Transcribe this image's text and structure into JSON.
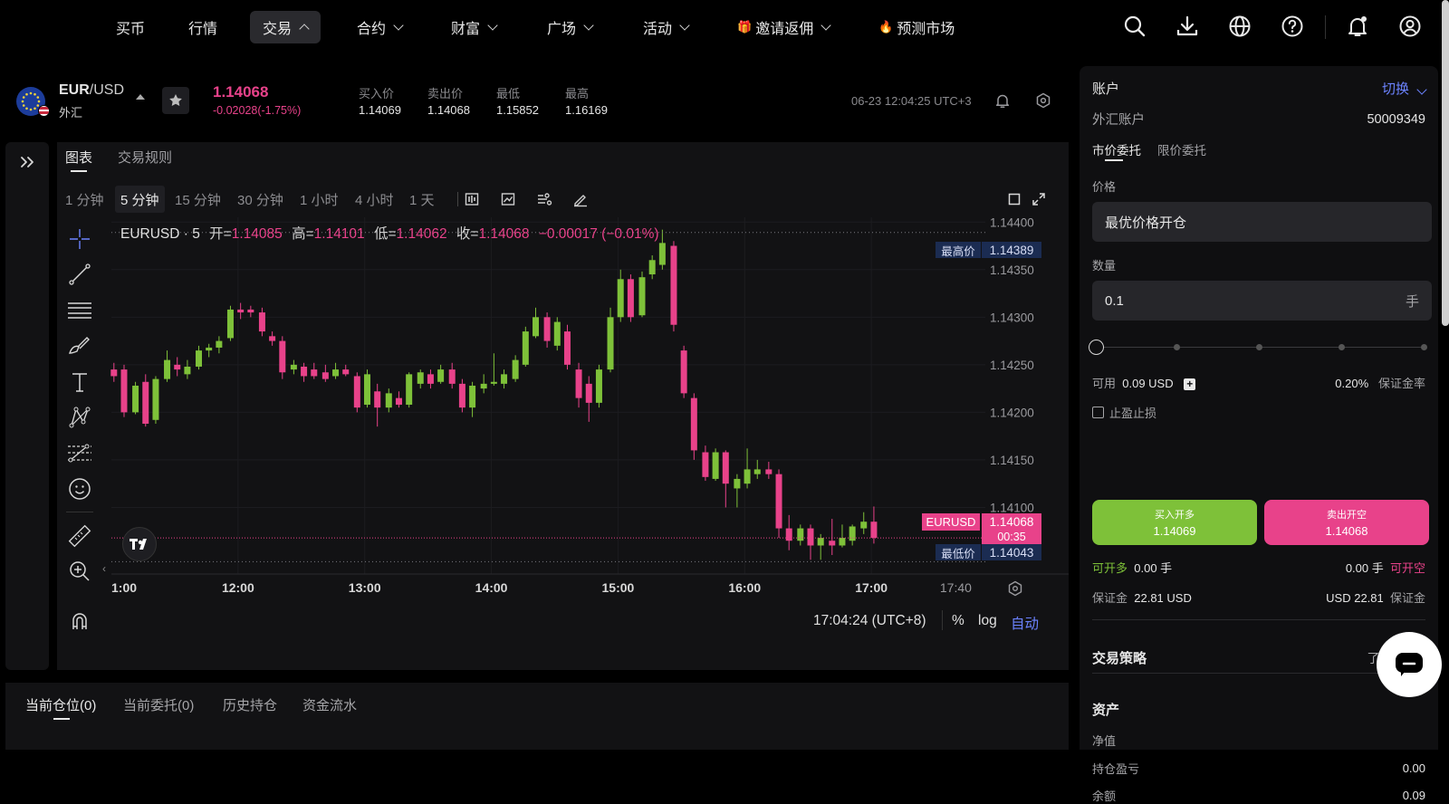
{
  "nav": {
    "items": [
      {
        "label": "买币"
      },
      {
        "label": "行情"
      },
      {
        "label": "交易"
      },
      {
        "label": "合约"
      },
      {
        "label": "财富"
      },
      {
        "label": "广场"
      },
      {
        "label": "活动"
      },
      {
        "label": "邀请返佣"
      },
      {
        "label": "预测市场"
      }
    ],
    "active": "交易",
    "icons": [
      "search-icon",
      "download-icon",
      "globe-icon",
      "help-icon",
      "bell-icon",
      "user-icon"
    ]
  },
  "symbol": {
    "pair": "EUR",
    "pair_quote": "/USD",
    "category": "外汇",
    "price": "1.14068",
    "change": "-0.02028(-1.75%)",
    "stats": [
      {
        "label": "买入价",
        "value": "1.14069"
      },
      {
        "label": "卖出价",
        "value": "1.14068"
      },
      {
        "label": "最低",
        "value": "1.15852"
      },
      {
        "label": "最高",
        "value": "1.16169"
      }
    ],
    "datetime": "06-23 12:04:25 UTC+3"
  },
  "chart_tabs": {
    "chart": "图表",
    "rules": "交易规则"
  },
  "timeframes": [
    "1 分钟",
    "5 分钟",
    "15 分钟",
    "30 分钟",
    "1 小时",
    "4 小时",
    "1 天"
  ],
  "active_timeframe": "5 分钟",
  "legend": {
    "symbol": "EURUSD · 5",
    "open_label": "开=",
    "open": "1.14085",
    "high_label": "高=",
    "high": "1.14101",
    "low_label": "低=",
    "low": "1.14062",
    "close_label": "收=",
    "close": "1.14068",
    "change": "−0.00017 (−0.01%)"
  },
  "chart_labels": {
    "high_tag": "最高价",
    "high_value": "1.14389",
    "low_tag": "最低价",
    "low_value": "1.14043",
    "last_tag": "EURUSD",
    "last_value": "1.14068",
    "countdown": "00:35"
  },
  "chart_footer": {
    "time": "17:04:24 (UTC+8)",
    "pct": "%",
    "log": "log",
    "auto": "自动"
  },
  "chart_data": {
    "type": "candlestick",
    "symbol": "EURUSD",
    "interval": "5",
    "y_ticks": [
      "1.14400",
      "1.14350",
      "1.14300",
      "1.14250",
      "1.14200",
      "1.14150",
      "1.14100"
    ],
    "ylim": [
      1.1403,
      1.14405
    ],
    "x_ticks": [
      {
        "label": "1:00",
        "t": 11.0
      },
      {
        "label": "12:00",
        "t": 12.0
      },
      {
        "label": "13:00",
        "t": 13.0
      },
      {
        "label": "14:00",
        "t": 14.0
      },
      {
        "label": "15:00",
        "t": 15.0
      },
      {
        "label": "16:00",
        "t": 16.0
      },
      {
        "label": "17:00",
        "t": 17.0
      },
      {
        "label": "17:40",
        "t": 17.667
      }
    ],
    "xlim": [
      11.0,
      17.9
    ],
    "candles": [
      {
        "t": 11.02,
        "o": 1.14245,
        "h": 1.14252,
        "l": 1.14232,
        "c": 1.14238
      },
      {
        "t": 11.1,
        "o": 1.14245,
        "h": 1.1425,
        "l": 1.14195,
        "c": 1.142
      },
      {
        "t": 11.19,
        "o": 1.142,
        "h": 1.14232,
        "l": 1.14198,
        "c": 1.14228
      },
      {
        "t": 11.27,
        "o": 1.14232,
        "h": 1.1424,
        "l": 1.14185,
        "c": 1.14188
      },
      {
        "t": 11.35,
        "o": 1.14192,
        "h": 1.14238,
        "l": 1.14188,
        "c": 1.14235
      },
      {
        "t": 11.44,
        "o": 1.14235,
        "h": 1.14265,
        "l": 1.14232,
        "c": 1.14255
      },
      {
        "t": 11.52,
        "o": 1.1425,
        "h": 1.14258,
        "l": 1.14238,
        "c": 1.14245
      },
      {
        "t": 11.6,
        "o": 1.1424,
        "h": 1.14255,
        "l": 1.14235,
        "c": 1.14248
      },
      {
        "t": 11.69,
        "o": 1.14248,
        "h": 1.1427,
        "l": 1.14245,
        "c": 1.14265
      },
      {
        "t": 11.77,
        "o": 1.14265,
        "h": 1.14272,
        "l": 1.14258,
        "c": 1.14268
      },
      {
        "t": 11.85,
        "o": 1.14268,
        "h": 1.1428,
        "l": 1.14262,
        "c": 1.14275
      },
      {
        "t": 11.94,
        "o": 1.14278,
        "h": 1.14312,
        "l": 1.14275,
        "c": 1.14308
      },
      {
        "t": 12.02,
        "o": 1.14308,
        "h": 1.14315,
        "l": 1.14298,
        "c": 1.14305
      },
      {
        "t": 12.1,
        "o": 1.14308,
        "h": 1.14312,
        "l": 1.143,
        "c": 1.14305
      },
      {
        "t": 12.19,
        "o": 1.14305,
        "h": 1.1431,
        "l": 1.1428,
        "c": 1.14285
      },
      {
        "t": 12.27,
        "o": 1.1428,
        "h": 1.14285,
        "l": 1.1427,
        "c": 1.14275
      },
      {
        "t": 12.35,
        "o": 1.14275,
        "h": 1.1428,
        "l": 1.14235,
        "c": 1.14242
      },
      {
        "t": 12.44,
        "o": 1.14245,
        "h": 1.14255,
        "l": 1.1424,
        "c": 1.1425
      },
      {
        "t": 12.52,
        "o": 1.14248,
        "h": 1.14252,
        "l": 1.14232,
        "c": 1.14238
      },
      {
        "t": 12.6,
        "o": 1.14245,
        "h": 1.14252,
        "l": 1.14235,
        "c": 1.14238
      },
      {
        "t": 12.69,
        "o": 1.14242,
        "h": 1.1425,
        "l": 1.14232,
        "c": 1.14235
      },
      {
        "t": 12.77,
        "o": 1.14238,
        "h": 1.14252,
        "l": 1.14235,
        "c": 1.14245
      },
      {
        "t": 12.85,
        "o": 1.14245,
        "h": 1.1425,
        "l": 1.14238,
        "c": 1.1424
      },
      {
        "t": 12.94,
        "o": 1.14238,
        "h": 1.14242,
        "l": 1.142,
        "c": 1.14205
      },
      {
        "t": 13.02,
        "o": 1.14208,
        "h": 1.14245,
        "l": 1.14205,
        "c": 1.1424
      },
      {
        "t": 13.1,
        "o": 1.14222,
        "h": 1.1423,
        "l": 1.14185,
        "c": 1.14205
      },
      {
        "t": 13.19,
        "o": 1.14205,
        "h": 1.14225,
        "l": 1.142,
        "c": 1.1422
      },
      {
        "t": 13.27,
        "o": 1.14215,
        "h": 1.14222,
        "l": 1.14205,
        "c": 1.14208
      },
      {
        "t": 13.35,
        "o": 1.14208,
        "h": 1.14242,
        "l": 1.14205,
        "c": 1.1424
      },
      {
        "t": 13.44,
        "o": 1.1423,
        "h": 1.14245,
        "l": 1.14225,
        "c": 1.14242
      },
      {
        "t": 13.52,
        "o": 1.1424,
        "h": 1.14245,
        "l": 1.14225,
        "c": 1.1423
      },
      {
        "t": 13.6,
        "o": 1.14232,
        "h": 1.1425,
        "l": 1.1423,
        "c": 1.14245
      },
      {
        "t": 13.69,
        "o": 1.14245,
        "h": 1.14252,
        "l": 1.14225,
        "c": 1.1423
      },
      {
        "t": 13.77,
        "o": 1.1423,
        "h": 1.14235,
        "l": 1.142,
        "c": 1.14205
      },
      {
        "t": 13.85,
        "o": 1.14205,
        "h": 1.14232,
        "l": 1.14195,
        "c": 1.14228
      },
      {
        "t": 13.94,
        "o": 1.14225,
        "h": 1.1424,
        "l": 1.1422,
        "c": 1.1423
      },
      {
        "t": 14.02,
        "o": 1.1423,
        "h": 1.14262,
        "l": 1.14228,
        "c": 1.14232
      },
      {
        "t": 14.1,
        "o": 1.1423,
        "h": 1.14245,
        "l": 1.14225,
        "c": 1.1424
      },
      {
        "t": 14.19,
        "o": 1.14235,
        "h": 1.1426,
        "l": 1.14232,
        "c": 1.14255
      },
      {
        "t": 14.27,
        "o": 1.1425,
        "h": 1.1429,
        "l": 1.14248,
        "c": 1.14285
      },
      {
        "t": 14.35,
        "o": 1.1428,
        "h": 1.1431,
        "l": 1.14278,
        "c": 1.143
      },
      {
        "t": 14.44,
        "o": 1.143,
        "h": 1.14305,
        "l": 1.14268,
        "c": 1.14275
      },
      {
        "t": 14.52,
        "o": 1.1427,
        "h": 1.143,
        "l": 1.14265,
        "c": 1.14295
      },
      {
        "t": 14.6,
        "o": 1.14285,
        "h": 1.14292,
        "l": 1.14245,
        "c": 1.1425
      },
      {
        "t": 14.69,
        "o": 1.14245,
        "h": 1.14252,
        "l": 1.14205,
        "c": 1.14215
      },
      {
        "t": 14.77,
        "o": 1.1423,
        "h": 1.14238,
        "l": 1.1419,
        "c": 1.1421
      },
      {
        "t": 14.85,
        "o": 1.1421,
        "h": 1.1425,
        "l": 1.14205,
        "c": 1.14245
      },
      {
        "t": 14.94,
        "o": 1.14245,
        "h": 1.1431,
        "l": 1.14242,
        "c": 1.143
      },
      {
        "t": 15.02,
        "o": 1.143,
        "h": 1.1435,
        "l": 1.14295,
        "c": 1.1434
      },
      {
        "t": 15.1,
        "o": 1.1434,
        "h": 1.14345,
        "l": 1.14295,
        "c": 1.143
      },
      {
        "t": 15.19,
        "o": 1.14302,
        "h": 1.14348,
        "l": 1.143,
        "c": 1.14342
      },
      {
        "t": 15.27,
        "o": 1.14345,
        "h": 1.14365,
        "l": 1.1434,
        "c": 1.1436
      },
      {
        "t": 15.35,
        "o": 1.14355,
        "h": 1.14392,
        "l": 1.1435,
        "c": 1.14378
      },
      {
        "t": 15.44,
        "o": 1.14375,
        "h": 1.1438,
        "l": 1.14285,
        "c": 1.14292
      },
      {
        "t": 15.52,
        "o": 1.14265,
        "h": 1.1427,
        "l": 1.14215,
        "c": 1.1422
      },
      {
        "t": 15.6,
        "o": 1.14215,
        "h": 1.1422,
        "l": 1.1415,
        "c": 1.1416
      },
      {
        "t": 15.69,
        "o": 1.14158,
        "h": 1.14165,
        "l": 1.14128,
        "c": 1.14132
      },
      {
        "t": 15.77,
        "o": 1.1413,
        "h": 1.14162,
        "l": 1.14128,
        "c": 1.14158
      },
      {
        "t": 15.85,
        "o": 1.14158,
        "h": 1.1416,
        "l": 1.141,
        "c": 1.14125
      },
      {
        "t": 15.94,
        "o": 1.1412,
        "h": 1.14135,
        "l": 1.141,
        "c": 1.1413
      },
      {
        "t": 16.02,
        "o": 1.14125,
        "h": 1.14162,
        "l": 1.1412,
        "c": 1.1414
      },
      {
        "t": 16.1,
        "o": 1.14135,
        "h": 1.1415,
        "l": 1.1413,
        "c": 1.1414
      },
      {
        "t": 16.19,
        "o": 1.1414,
        "h": 1.14148,
        "l": 1.1413,
        "c": 1.14135
      },
      {
        "t": 16.27,
        "o": 1.14135,
        "h": 1.1414,
        "l": 1.14068,
        "c": 1.14078
      },
      {
        "t": 16.35,
        "o": 1.14078,
        "h": 1.14092,
        "l": 1.14055,
        "c": 1.14065
      },
      {
        "t": 16.44,
        "o": 1.14065,
        "h": 1.14082,
        "l": 1.1406,
        "c": 1.14078
      },
      {
        "t": 16.52,
        "o": 1.14078,
        "h": 1.14082,
        "l": 1.14045,
        "c": 1.1406
      },
      {
        "t": 16.6,
        "o": 1.1406,
        "h": 1.14072,
        "l": 1.14045,
        "c": 1.14068
      },
      {
        "t": 16.69,
        "o": 1.14065,
        "h": 1.14088,
        "l": 1.1405,
        "c": 1.1406
      },
      {
        "t": 16.77,
        "o": 1.1406,
        "h": 1.14082,
        "l": 1.14058,
        "c": 1.14068
      },
      {
        "t": 16.85,
        "o": 1.14065,
        "h": 1.14082,
        "l": 1.1406,
        "c": 1.1408
      },
      {
        "t": 16.94,
        "o": 1.14078,
        "h": 1.14095,
        "l": 1.14072,
        "c": 1.14085
      },
      {
        "t": 17.02,
        "o": 1.14085,
        "h": 1.14101,
        "l": 1.14062,
        "c": 1.14068
      }
    ],
    "high_line": 1.14389,
    "low_line": 1.14043,
    "last": 1.14068,
    "up_color": "#7ec139",
    "down_color": "#e8428a"
  },
  "account": {
    "title": "账户",
    "switch": "切换",
    "type_label": "外汇账户",
    "number": "50009349",
    "order_tabs": [
      "市价委托",
      "限价委托"
    ],
    "price_label": "价格",
    "price_value": "最优价格开仓",
    "qty_label": "数量",
    "qty_value": "0.1",
    "qty_unit": "手",
    "slider_fraction": 0,
    "available_label": "可用",
    "available": "0.09 USD",
    "margin_rate": "0.20%",
    "margin_rate_label": "保证金率",
    "tpsl": "止盈止损",
    "buy_label": "买入开多",
    "buy_price": "1.14069",
    "sell_label": "卖出开空",
    "sell_price": "1.14068",
    "long_label": "可开多",
    "long_value": "0.00 手",
    "short_value": "0.00 手",
    "short_label": "可开空",
    "margin_label": "保证金",
    "margin_left": "22.81 USD",
    "margin_right": "USD 22.81",
    "margin_right_label": "保证金",
    "strategy": "交易策略",
    "strategy_link": "了解详情",
    "assets": "资产",
    "equity_label": "净值",
    "pnl_label": "持仓盈亏",
    "pnl_value": "0.00",
    "balance_label": "余额",
    "balance_value": "0.09"
  },
  "bottom_tabs": [
    "当前仓位(0)",
    "当前委托(0)",
    "历史持仓",
    "资金流水"
  ],
  "colors": {
    "up": "#7ec139",
    "down": "#e8428a",
    "accent": "#6c83ff",
    "bg": "#000000",
    "panel": "#121214"
  }
}
